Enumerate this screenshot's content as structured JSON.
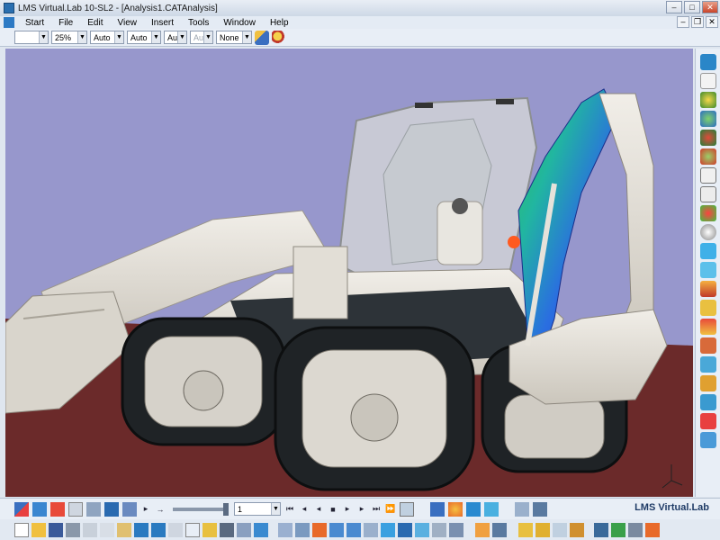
{
  "window": {
    "title": "LMS Virtual.Lab 10-SL2 - [Analysis1.CATAnalysis]"
  },
  "menu": {
    "items": [
      "Start",
      "File",
      "Edit",
      "View",
      "Insert",
      "Tools",
      "Window",
      "Help"
    ]
  },
  "toolbar": {
    "line_style": "",
    "zoom": "25%",
    "color_auto": "Auto",
    "thickness_auto": "Auto",
    "layer_auto": "Aut",
    "layer_auto_disabled": "Aut",
    "render_mode": "None"
  },
  "animation": {
    "frame_value": "1"
  },
  "brand": {
    "label": "LMS Virtual.Lab"
  },
  "colors": {
    "sky": "#9797cc",
    "floor": "#6b2a2a",
    "body": "#e6e2da",
    "cab_dark": "#2d3338"
  }
}
